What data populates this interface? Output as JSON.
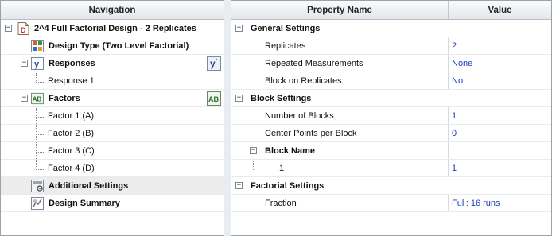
{
  "navigation": {
    "header": "Navigation",
    "root": "2^4 Full Factorial Design - 2 Replicates",
    "design_type": "Design Type (Two Level Factorial)",
    "responses": "Responses",
    "response_items": [
      "Response 1"
    ],
    "factors": "Factors",
    "factor_items": [
      "Factor 1 (A)",
      "Factor 2 (B)",
      "Factor 3 (C)",
      "Factor 4 (D)"
    ],
    "additional_settings": "Additional Settings",
    "design_summary": "Design Summary",
    "icons": {
      "root": "document-d-icon",
      "design_type": "design-type-icon",
      "responses": "response-y-icon",
      "factors": "factor-ab-icon",
      "additional_settings": "settings-gear-icon",
      "design_summary": "summary-icon"
    }
  },
  "properties": {
    "header_name": "Property Name",
    "header_value": "Value",
    "general_settings": {
      "title": "General Settings",
      "rows": [
        {
          "name": "Replicates",
          "value": "2"
        },
        {
          "name": "Repeated Measurements",
          "value": "None"
        },
        {
          "name": "Block on Replicates",
          "value": "No"
        }
      ]
    },
    "block_settings": {
      "title": "Block Settings",
      "rows": [
        {
          "name": "Number of Blocks",
          "value": "1"
        },
        {
          "name": "Center Points per Block",
          "value": "0"
        }
      ],
      "block_name": {
        "title": "Block Name",
        "rows": [
          {
            "name": "1",
            "value": "1"
          }
        ]
      }
    },
    "factorial_settings": {
      "title": "Factorial Settings",
      "rows": [
        {
          "name": "Fraction",
          "value": "Full: 16 runs"
        }
      ]
    }
  },
  "colors": {
    "value_text": "#1a3dbf",
    "selected_row": "#ececec",
    "panel_border": "#9aa3ad"
  }
}
